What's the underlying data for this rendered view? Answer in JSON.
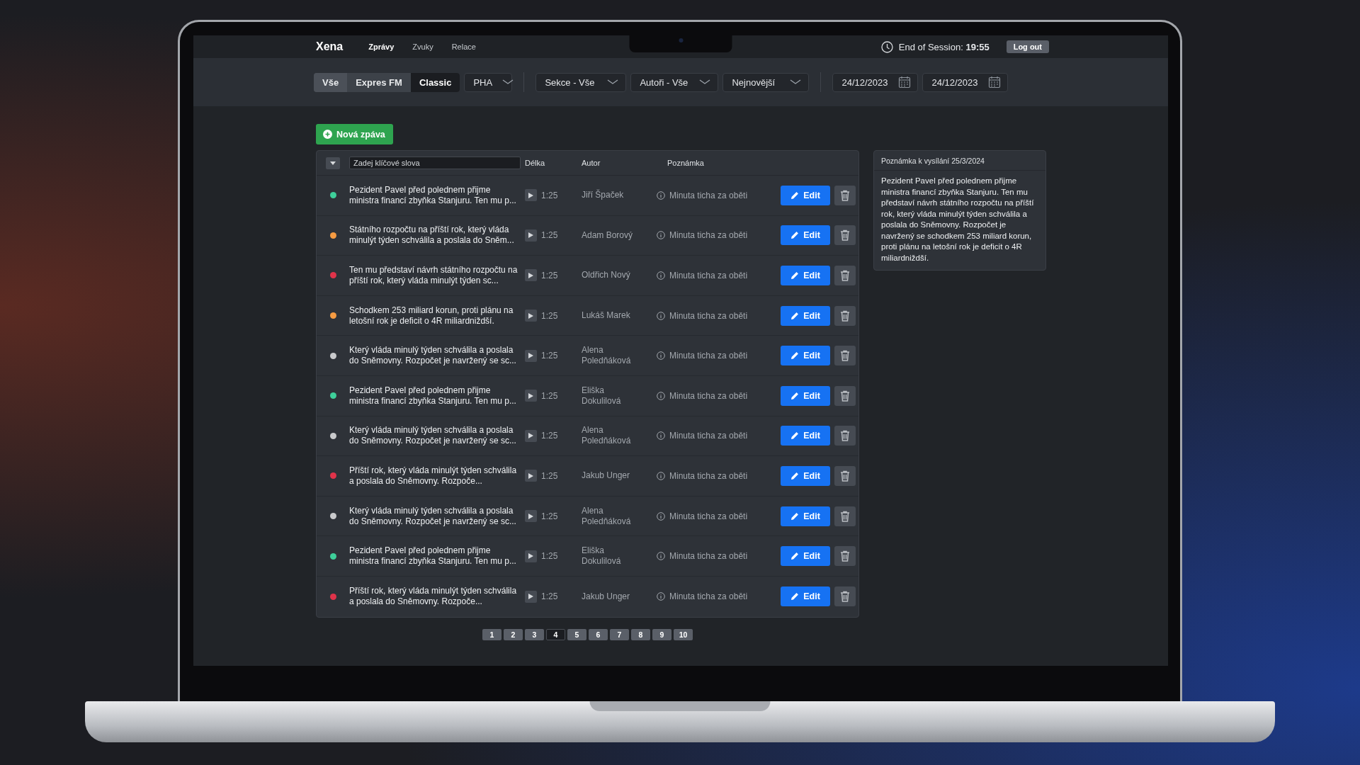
{
  "app": {
    "logo": "Xena",
    "nav": [
      {
        "label": "Zprávy",
        "selected": true
      },
      {
        "label": "Zvuky",
        "selected": false
      },
      {
        "label": "Relace",
        "selected": false
      }
    ],
    "session": "End of Session: **19:55**",
    "logout": "Log out"
  },
  "filters": {
    "stations": [
      {
        "label": "Vše",
        "selected": false
      },
      {
        "label": "Expres FM",
        "selected": false
      },
      {
        "label": "Classic",
        "selected": true
      }
    ],
    "region": "PHA",
    "dropdowns": [
      "Sekce - Vše",
      "Autoři - Vše",
      "Nejnovější"
    ],
    "dates": [
      "24/12/2023",
      "24/12/2023"
    ]
  },
  "new_button": "Nová zpáva",
  "table": {
    "search": {
      "placeholder": "Zadej klíčové slova"
    },
    "columns": [
      "Délka",
      "Autor",
      "Poznámka"
    ],
    "rows": [
      {
        "color": "#3ecf9a",
        "text": "Pezident Pavel před polednem přijme ministra financí zbyňka Stanjuru. Ten mu p...",
        "length": "1:25",
        "author": "Jiří Špaček",
        "note": "Minuta ticha za oběti",
        "edit": "Edit"
      },
      {
        "color": "#f59b42",
        "text": "Státního rozpočtu na příští rok, který vláda minulýt týden schválila a poslala do Sněm...",
        "length": "1:25",
        "author": "Adam Borový",
        "note": "Minuta ticha za oběti",
        "edit": "Edit"
      },
      {
        "color": "#e0334a",
        "text": "Ten mu představí návrh státního rozpočtu na příští rok, který vláda minulýt týden sc...",
        "length": "1:25",
        "author": "Oldřich Nový",
        "note": "Minuta ticha za oběti",
        "edit": "Edit"
      },
      {
        "color": "#f59b42",
        "text": "Schodkem 253 miliard korun, proti plánu na letošní rok je deficit o 4R miliardniždší.",
        "length": "1:25",
        "author": "Lukáš Marek",
        "note": "Minuta ticha za oběti",
        "edit": "Edit"
      },
      {
        "color": "#c9cacc",
        "text": "Který vláda minulý týden schválila a poslala do Sněmovny. Rozpočet je navržený se sc...",
        "length": "1:25",
        "author": "Alena Poledňáková",
        "note": "Minuta ticha za oběti",
        "edit": "Edit"
      },
      {
        "color": "#3ecf9a",
        "text": "Pezident Pavel před polednem přijme ministra financí zbyňka Stanjuru. Ten mu p...",
        "length": "1:25",
        "author": "Eliška Dokulilová",
        "note": "Minuta ticha za oběti",
        "edit": "Edit"
      },
      {
        "color": "#c9cacc",
        "text": "Který vláda minulý týden schválila a poslala do Sněmovny. Rozpočet je navržený se sc...",
        "length": "1:25",
        "author": "Alena Poledňáková",
        "note": "Minuta ticha za oběti",
        "edit": "Edit"
      },
      {
        "color": "#e0334a",
        "text": "Příští rok, který vláda minulýt týden schválila a poslala do Sněmovny. Rozpoče...",
        "length": "1:25",
        "author": "Jakub Unger",
        "note": "Minuta ticha za oběti",
        "edit": "Edit"
      },
      {
        "color": "#c9cacc",
        "text": "Který vláda minulý týden schválila a poslala do Sněmovny. Rozpočet je navržený se sc...",
        "length": "1:25",
        "author": "Alena Poledňáková",
        "note": "Minuta ticha za oběti",
        "edit": "Edit"
      },
      {
        "color": "#3ecf9a",
        "text": "Pezident Pavel před polednem přijme ministra financí zbyňka Stanjuru. Ten mu p...",
        "length": "1:25",
        "author": "Eliška Dokulilová",
        "note": "Minuta ticha za oběti",
        "edit": "Edit"
      },
      {
        "color": "#e0334a",
        "text": "Příští rok, který vláda minulýt týden schválila a poslala do Sněmovny. Rozpoče...",
        "length": "1:25",
        "author": "Jakub Unger",
        "note": "Minuta ticha za oběti",
        "edit": "Edit"
      }
    ]
  },
  "pagination": [
    {
      "label": "1",
      "selected": false
    },
    {
      "label": "2",
      "selected": false
    },
    {
      "label": "3",
      "selected": false
    },
    {
      "label": "4",
      "selected": true
    },
    {
      "label": "5",
      "selected": false
    },
    {
      "label": "6",
      "selected": false
    },
    {
      "label": "7",
      "selected": false
    },
    {
      "label": "8",
      "selected": false
    },
    {
      "label": "9",
      "selected": false
    },
    {
      "label": "10",
      "selected": false
    }
  ],
  "note_panel": {
    "title": "Poznámka k vysílání 25/3/2024",
    "body": "Pezident Pavel před polednem přijme ministra financí zbyňka Stanjuru. Ten mu představí návrh státního rozpočtu na příští rok, který vláda minulýt týden schválila a poslala do Sněmovny. Rozpočet je navržený se schodkem 253 miliard korun, proti plánu na letošní rok je deficit o 4R miliardniždší."
  }
}
